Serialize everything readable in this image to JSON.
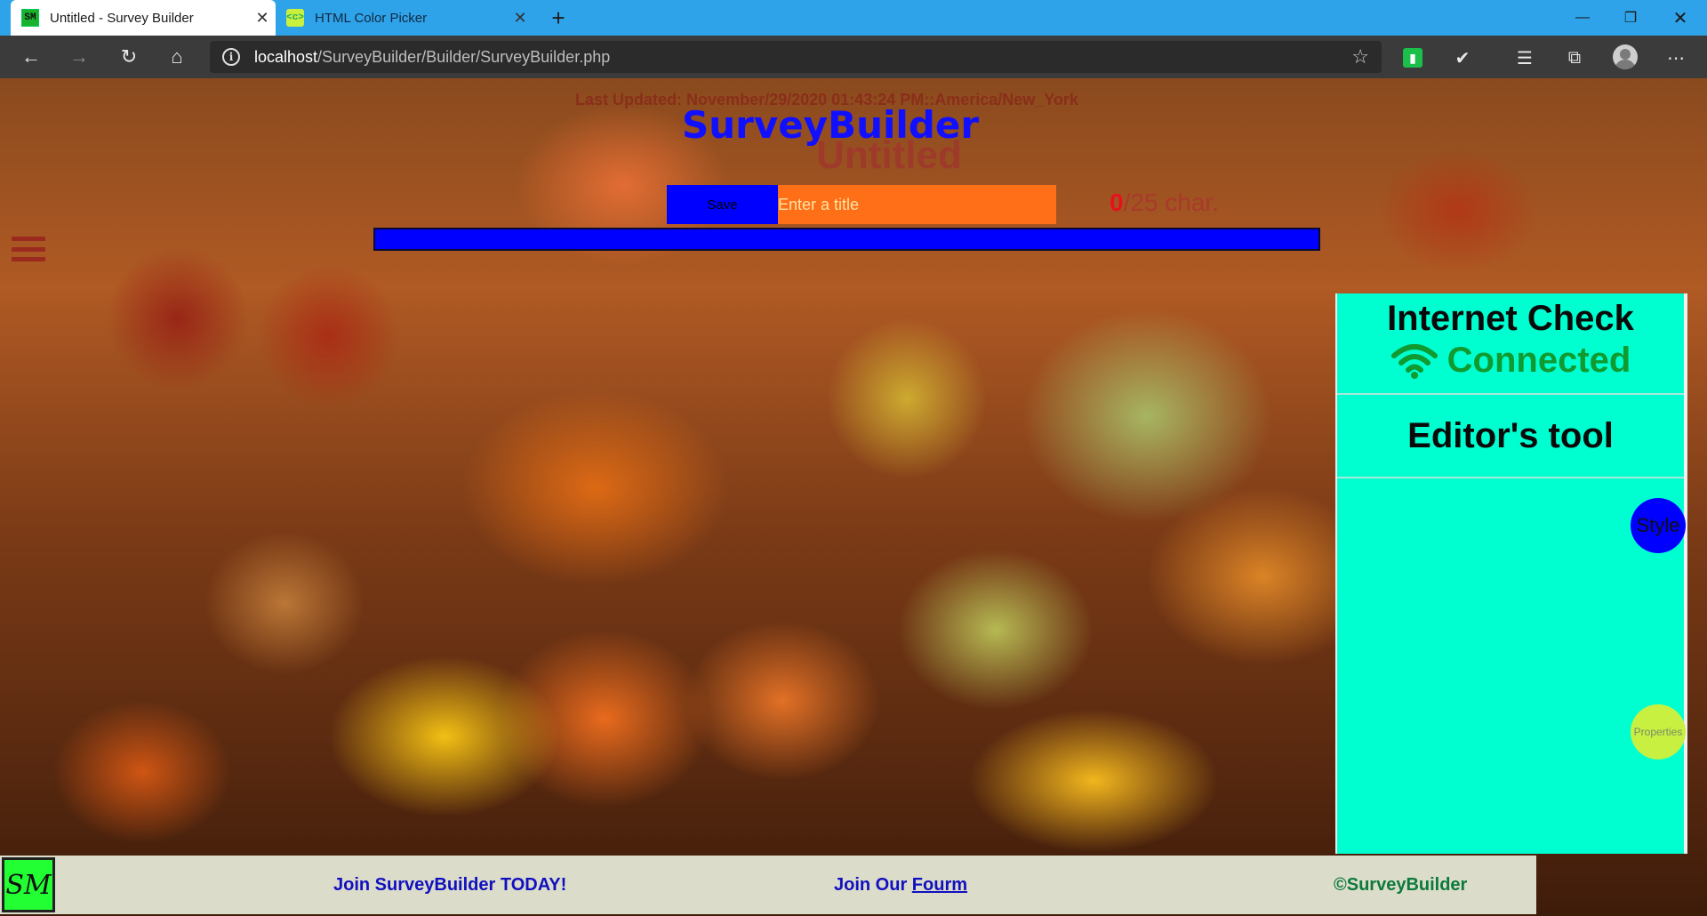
{
  "browser": {
    "tabs": [
      {
        "title": "Untitled - Survey Builder",
        "favicon_text": "SM",
        "active": true
      },
      {
        "title": "HTML Color Picker",
        "favicon_text": "<c>",
        "active": false
      }
    ],
    "url_host": "localhost",
    "url_path": "/SurveyBuilder/Builder/SurveyBuilder.php"
  },
  "page": {
    "last_updated": "Last Updated: November/29/2020 01:43:24 PM::America/New_York",
    "site_title": "SurveyBuilder",
    "survey_title": "Untitled",
    "save_label": "Save",
    "title_placeholder": "Enter a title",
    "char_count_num": "0",
    "char_count_rest": "/25 char."
  },
  "panel": {
    "internet_heading": "Internet Check",
    "connection_status": "Connected",
    "editor_heading": "Editor's tool",
    "style_label": "Style",
    "properties_label": "Properties"
  },
  "footer": {
    "logo_text": "SM",
    "join_text": "Join SurveyBuilder TODAY!",
    "forum_prefix": "Join Our ",
    "forum_link": "Fourm",
    "copyright": "©SurveyBuilder"
  },
  "colors": {
    "tabbar": "#2fa3e9",
    "panel": "#00ffd0",
    "save_button": "#0000ff",
    "title_input": "#ff6f17",
    "connected_green": "#109a30"
  }
}
